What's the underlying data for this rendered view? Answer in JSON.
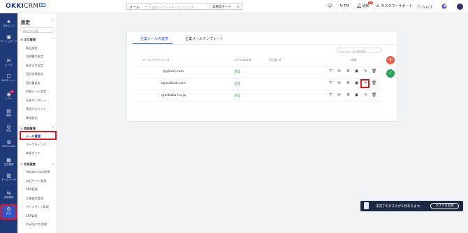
{
  "app": {
    "logo_text": "OKKI",
    "logo_suffix": "CRM",
    "logo_badge": "BI"
  },
  "topbar": {
    "search_scope": "メール",
    "search_placeholder": "検索キーワードを入力してください",
    "search_mode": "高精度モード",
    "items": {
      "tm": "TM",
      "notice": "通知",
      "notice_count": "99",
      "support": "カスタマーサポート",
      "help": "ヘルプ"
    }
  },
  "iconnav": {
    "items": [
      {
        "label": "お気に入り",
        "icon": "star-icon"
      },
      {
        "label": "ダッシュボード",
        "icon": "dashboard-icon"
      },
      {
        "label": "メール",
        "icon": "mail-icon"
      },
      {
        "label": "SNSチャット",
        "icon": "chat-icon"
      },
      {
        "label": "リード",
        "icon": "lead-icon",
        "badge": "10"
      },
      {
        "label": "顧客",
        "icon": "customer-icon"
      },
      {
        "label": "商談",
        "icon": "deal-icon"
      },
      {
        "label": "OKKI Leads",
        "icon": "leads-icon"
      },
      {
        "label": "注文管理",
        "icon": "order-icon"
      },
      {
        "label": "チームデータ",
        "icon": "team-data-icon"
      },
      {
        "label": "承認管理",
        "icon": "approval-icon"
      },
      {
        "label": "設定",
        "icon": "settings-icon"
      }
    ]
  },
  "sidebar": {
    "title": "設定",
    "search_placeholder": "機能名を検索",
    "sections": [
      {
        "title": "注文管理",
        "items": [
          "製品設定",
          "見積書の設定",
          "販売注文設定",
          "回収金額設定",
          "回収書設定",
          "為替レート設定",
          "伝票テンプレー...",
          "資金アカウント",
          "費用設定"
        ]
      },
      {
        "title": "商談管理",
        "items": [
          "メール管理",
          "マーケティング...",
          "商談ガイド"
        ]
      },
      {
        "title": "外部連携",
        "items": [
          "Alibaba.com連携",
          "自社サイト管理",
          "SNS管理",
          "企業微信管理",
          "ディンディン管理",
          "ERP管理",
          "PayPalでの受取"
        ]
      }
    ]
  },
  "main": {
    "tabs": [
      "企業メールの連携",
      "企業メールテンプレート"
    ],
    "table_search_placeholder": "メール、担当者検索",
    "columns": {
      "account": "メールアカウント",
      "status": "メールの状態",
      "owner": "担当者",
      "detail": "詳細"
    },
    "rows": [
      {
        "account": "l@gmail.com",
        "status": "正常",
        "owner": ""
      },
      {
        "account": "t@outlook.com",
        "status": "正常",
        "owner": ""
      },
      {
        "account": "@alibaba-inc.jp",
        "status": "正常",
        "owner": ""
      }
    ],
    "row_actions": [
      "shield-icon",
      "mail-icon",
      "gear-icon",
      "monitor-icon",
      "edit-icon",
      "trash-icon"
    ]
  },
  "fabs": {
    "add": "+",
    "shield": "✓"
  },
  "toast": {
    "text": "未完了のタスクが２件あります。",
    "button": "タスクを実施"
  },
  "colors": {
    "nav_bg": "#1e3a78",
    "accent": "#2a5ad6",
    "status_ok": "#24a148",
    "highlight": "#e8131a",
    "fab_add": "#f05a4a",
    "fab_shield": "#26a65b"
  }
}
